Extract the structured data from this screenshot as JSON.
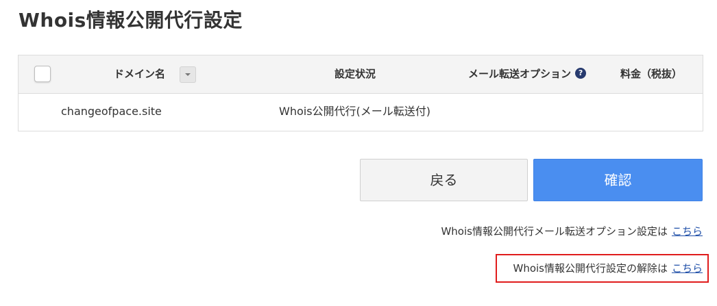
{
  "page": {
    "title": "Whois情報公開代行設定"
  },
  "table": {
    "headers": {
      "domain": "ドメイン名",
      "status": "設定状況",
      "mail_option": "メール転送オプション",
      "price": "料金（税抜）"
    },
    "help_icon": "?",
    "rows": [
      {
        "domain": "changeofpace.site",
        "status": "Whois公開代行(メール転送付)",
        "mail_option": "",
        "price": ""
      }
    ]
  },
  "buttons": {
    "back": "戻る",
    "confirm": "確認"
  },
  "links": {
    "mail_option_text": "Whois情報公開代行メール転送オプション設定は",
    "mail_option_link": "こちら",
    "cancel_text": "Whois情報公開代行設定の解除は",
    "cancel_link": "こちら"
  },
  "colors": {
    "primary": "#4a8ef0",
    "highlight_border": "#e01b1b",
    "link": "#1f4fa8"
  }
}
